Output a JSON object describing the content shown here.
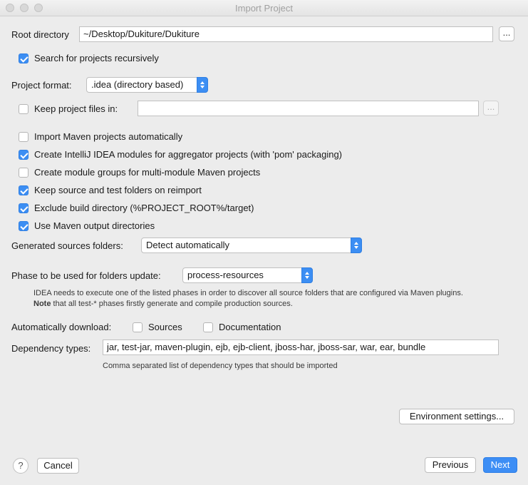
{
  "window": {
    "title": "Import Project"
  },
  "root_directory": {
    "label": "Root directory",
    "value": "~/Desktop/Dukiture/Dukiture",
    "browse_label": "..."
  },
  "search_recursive": {
    "label": "Search for projects recursively",
    "checked": true
  },
  "project_format": {
    "label": "Project format:",
    "value": ".idea (directory based)"
  },
  "keep_project_files": {
    "label": "Keep project files in:",
    "checked": false,
    "value": "",
    "browse_label": "..."
  },
  "options": [
    {
      "label": "Import Maven projects automatically",
      "checked": false
    },
    {
      "label": "Create IntelliJ IDEA modules for aggregator projects (with 'pom' packaging)",
      "checked": true
    },
    {
      "label": "Create module groups for multi-module Maven projects",
      "checked": false
    },
    {
      "label": "Keep source and test folders on reimport",
      "checked": true
    },
    {
      "label": "Exclude build directory (%PROJECT_ROOT%/target)",
      "checked": true
    },
    {
      "label": "Use Maven output directories",
      "checked": true
    }
  ],
  "generated_sources": {
    "label": "Generated sources folders:",
    "value": "Detect automatically"
  },
  "phase": {
    "label": "Phase to be used for folders update:",
    "value": "process-resources",
    "note_line1": "IDEA needs to execute one of the listed phases in order to discover all source folders that are configured via Maven plugins.",
    "note_bold": "Note",
    "note_line2": " that all test-* phases firstly generate and compile production sources."
  },
  "auto_download": {
    "label": "Automatically download:",
    "sources": {
      "label": "Sources",
      "checked": false
    },
    "documentation": {
      "label": "Documentation",
      "checked": false
    }
  },
  "dependency_types": {
    "label": "Dependency types:",
    "value": "jar, test-jar, maven-plugin, ejb, ejb-client, jboss-har, jboss-sar, war, ear, bundle",
    "hint": "Comma separated list of dependency types that should be imported"
  },
  "buttons": {
    "environment": "Environment settings...",
    "help": "?",
    "cancel": "Cancel",
    "previous": "Previous",
    "next": "Next"
  },
  "colors": {
    "accent": "#3c8ef3",
    "background": "#ececec"
  }
}
